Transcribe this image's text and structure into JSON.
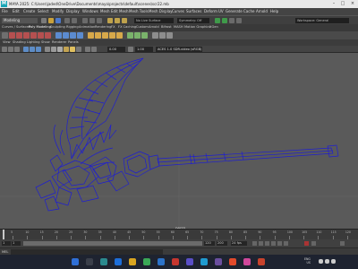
{
  "window": {
    "title": "MAYA 2025: C:\\Users\\jaded\\OneDrive\\Documents\\maya\\projects\\default\\scenes\\scr22.mb",
    "logo": "M"
  },
  "menubar": {
    "items": [
      "File",
      "Edit",
      "Create",
      "Select",
      "Modify",
      "Display",
      "Windows",
      "Mesh",
      "Edit Mesh",
      "Mesh Tools",
      "Mesh Display",
      "Curves",
      "Surfaces",
      "Deform",
      "UV",
      "Generate",
      "Cache",
      "Arnold",
      "Help"
    ]
  },
  "statusline": {
    "mode": "Modeling",
    "no_live_surface": "No Live Surface",
    "symmetry": "Symmetry: Off",
    "workspace": "Workspace: General"
  },
  "shelf": {
    "tabs": [
      "Curves / Surfaces",
      "Poly Modeling",
      "Sculpting",
      "Rigging",
      "Animation",
      "Rendering",
      "FX",
      "FX Caching",
      "Custom",
      "Arnold",
      "Bifrost",
      "MASH",
      "Motion Graphics",
      "XGen"
    ]
  },
  "viewpanel": {
    "menus": [
      "View",
      "Shading",
      "Lighting",
      "Show",
      "Renderer",
      "Panels"
    ]
  },
  "viewtoolbar": {
    "field_near": "0.00",
    "field_far": "1.00",
    "colorspace": "ACES 1.0 SDR-video (sRGB)"
  },
  "viewport": {
    "camera_label": "persp",
    "wire_color": "#1f1fd0",
    "bg_color": "#5a5a5a"
  },
  "timeslider": {
    "ticks": [
      "5",
      "10",
      "15",
      "20",
      "25",
      "30",
      "35",
      "40",
      "45",
      "50",
      "55",
      "60",
      "65",
      "70",
      "75",
      "80",
      "85",
      "90",
      "95",
      "100",
      "105",
      "110",
      "115",
      "120"
    ],
    "current_frame": "1"
  },
  "rangeslider": {
    "start": "1",
    "inner_start": "1",
    "inner_end": "120",
    "end": "200",
    "fps": "24 fps"
  },
  "cmdline": {
    "label": "MEL"
  },
  "taskbar": {
    "tray_lang": "ENG",
    "tray_region": "US",
    "time": "",
    "date": ""
  }
}
